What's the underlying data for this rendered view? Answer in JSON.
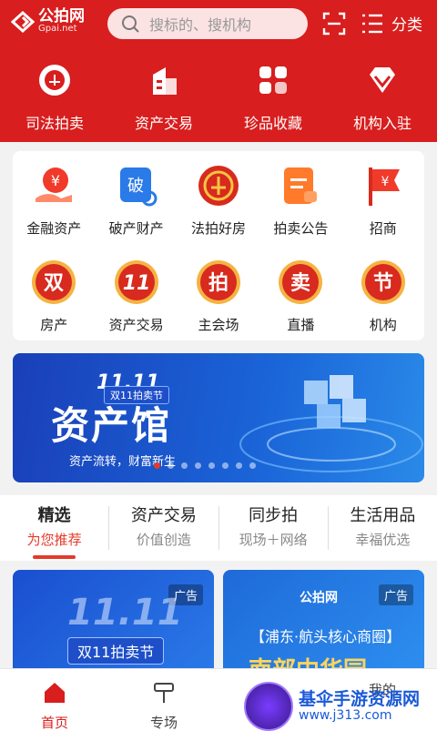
{
  "header": {
    "logo_cn": "公拍网",
    "logo_en": "Gpai.net",
    "search_placeholder": "搜标的、搜机构",
    "category_label": "分类",
    "accent": "#d81e1e"
  },
  "top_nav": [
    {
      "label": "司法拍卖",
      "icon": "judicial-seal-icon"
    },
    {
      "label": "资产交易",
      "icon": "building-icon"
    },
    {
      "label": "珍品收藏",
      "icon": "collection-grid-icon"
    },
    {
      "label": "机构入驻",
      "icon": "diamond-icon"
    }
  ],
  "grid_row1": [
    {
      "label": "金融资产",
      "icon": "yuan-hand-icon"
    },
    {
      "label": "破产财产",
      "icon": "bankrupt-search-icon",
      "glyph": "破"
    },
    {
      "label": "法拍好房",
      "icon": "court-emblem-icon"
    },
    {
      "label": "拍卖公告",
      "icon": "notice-doc-icon"
    },
    {
      "label": "招商",
      "icon": "yuan-flag-icon"
    }
  ],
  "grid_row2": [
    {
      "label": "房产",
      "glyph": "双",
      "icon": "double-badge-icon"
    },
    {
      "label": "资产交易",
      "glyph": "11",
      "icon": "eleven-badge-icon"
    },
    {
      "label": "主会场",
      "glyph": "拍",
      "icon": "auction-badge-icon"
    },
    {
      "label": "直播",
      "glyph": "卖",
      "icon": "sell-badge-icon"
    },
    {
      "label": "机构",
      "glyph": "节",
      "icon": "festival-badge-icon"
    }
  ],
  "banner": {
    "badge": "11.11",
    "badge_sub": "双11拍卖节",
    "title": "资产馆",
    "subtitle": "资产流转，财富新生",
    "dot_count": 8,
    "active_dot": 0
  },
  "tabs": [
    {
      "title": "精选",
      "sub": "为您推荐",
      "active": true
    },
    {
      "title": "资产交易",
      "sub": "价值创造",
      "active": false
    },
    {
      "title": "同步拍",
      "sub": "现场＋网络",
      "active": false
    },
    {
      "title": "生活用品",
      "sub": "幸福优选",
      "active": false
    }
  ],
  "cards": [
    {
      "ad": "广告",
      "big": "11.11",
      "label": "双11拍卖节"
    },
    {
      "ad": "广告",
      "brand": "公拍网",
      "area": "【浦东·航头核心商圈】",
      "name": "南部中华园"
    }
  ],
  "bottom_nav": [
    {
      "label": "首页",
      "active": true
    },
    {
      "label": "专场",
      "active": false
    },
    {
      "label": "",
      "active": false
    },
    {
      "label": "我的",
      "active": false
    }
  ],
  "watermark": {
    "title": "基伞手游资源网",
    "url": "www.j313.com"
  }
}
